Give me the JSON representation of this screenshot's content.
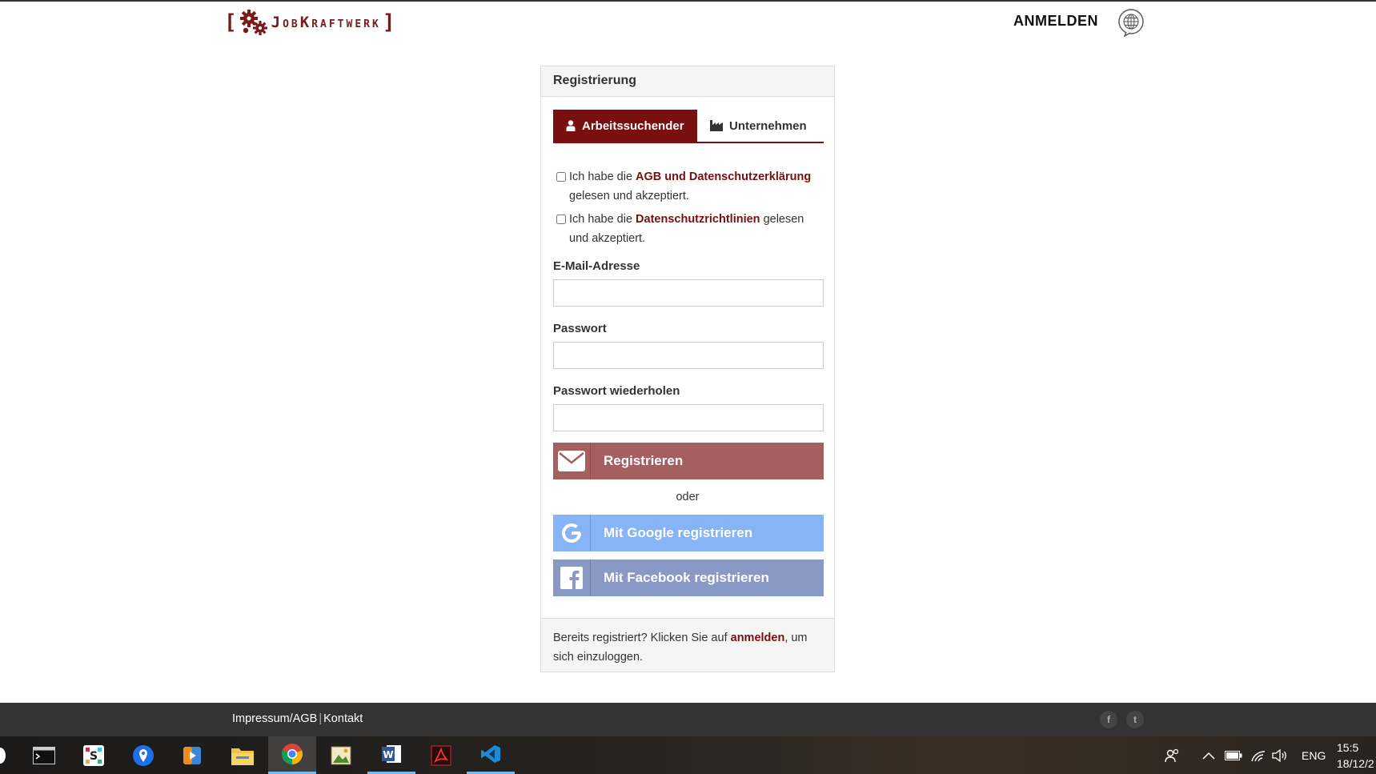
{
  "header": {
    "logo_left_bracket": "[",
    "logo_name": "JobKraftwerk",
    "logo_right_bracket": "]",
    "login_label": "ANMELDEN",
    "language_icon": "globe-speech-icon"
  },
  "registration": {
    "title": "Registrierung",
    "tabs": [
      {
        "label": "Arbeitssuchender",
        "icon": "user-icon",
        "active": true
      },
      {
        "label": "Unternehmen",
        "icon": "factory-icon",
        "active": false
      }
    ],
    "terms": {
      "prefix": "Ich habe die ",
      "link": "AGB und Datenschutzerklärung",
      "suffix": " gelesen und akzeptiert.",
      "checked": false
    },
    "privacy": {
      "prefix": "Ich habe die ",
      "link": "Datenschutzrichtlinien",
      "suffix": " gelesen und akzeptiert.",
      "checked": false
    },
    "email_label": "E-Mail-Adresse",
    "email_value": "",
    "password_label": "Passwort",
    "password_value": "",
    "password_repeat_label": "Passwort wiederholen",
    "password_repeat_value": "",
    "register_button": "Registrieren",
    "or_label": "oder",
    "google_button": "Mit Google registrieren",
    "facebook_button": "Mit Facebook registrieren",
    "footer": {
      "prefix": "Bereits registriert? Klicken Sie auf ",
      "link": "anmelden",
      "suffix": ", um sich einzuloggen."
    }
  },
  "site_footer": {
    "impressum": "Impressum/AGB",
    "separator": "|",
    "kontakt": "Kontakt",
    "social": [
      "f",
      "t"
    ]
  },
  "taskbar": {
    "apps": [
      "terminal-icon",
      "slack-icon",
      "maps-pin-icon",
      "media-player-icon",
      "file-explorer-icon",
      "chrome-icon",
      "image-viewer-icon",
      "word-icon",
      "acrobat-icon",
      "vscode-icon"
    ],
    "language": "ENG",
    "time": "15:5",
    "date": "18/12/2"
  },
  "colors": {
    "brand": "#7a0f0f",
    "register_button": "#a55f5f",
    "google_button": "#86b4f6",
    "facebook_button": "#8799c4",
    "footer_bg": "#333333"
  }
}
